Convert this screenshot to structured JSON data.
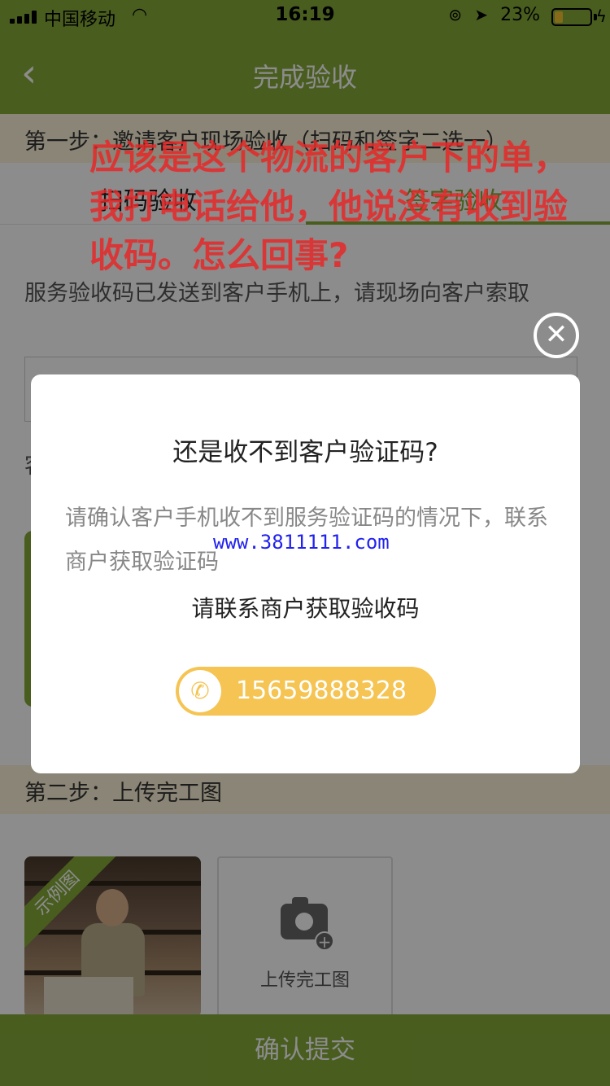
{
  "status_bar": {
    "carrier": "中国移动",
    "time": "16:19",
    "battery_percent": "23%"
  },
  "nav": {
    "back_icon": "chevron-left-icon",
    "title": "完成验收"
  },
  "step1": {
    "label": "第一步：邀请客户现场验收（扫码和签字二选一）"
  },
  "tabs": [
    {
      "label": "扫码验收",
      "active": false
    },
    {
      "label": "签字验收",
      "active": true
    }
  ],
  "hint": "服务验收码已发送到客户手机上，请现场向客户索取",
  "partial_text": "客",
  "step2": {
    "label": "第二步：上传完工图"
  },
  "photos": {
    "sample_ribbon": "示例图",
    "upload_label": "上传完工图"
  },
  "submit": {
    "label": "确认提交"
  },
  "colors": {
    "brand_green": "#86a93a",
    "step_bg": "#fbf3d7",
    "phone_button": "#f5c452"
  },
  "dialog": {
    "title": "还是收不到客户验证码?",
    "description": "请确认客户手机收不到服务验证码的情况下，联系商户获取验证码",
    "subtitle": "请联系商户获取验收码",
    "phone_number": "15659888328",
    "phone_icon": "phone-icon",
    "close_icon": "close-icon"
  },
  "watermark": "www.3811111.com",
  "annotation": "应该是这个物流的客户下的单，我打电话给他，他说没有收到验收码。怎么回事?"
}
